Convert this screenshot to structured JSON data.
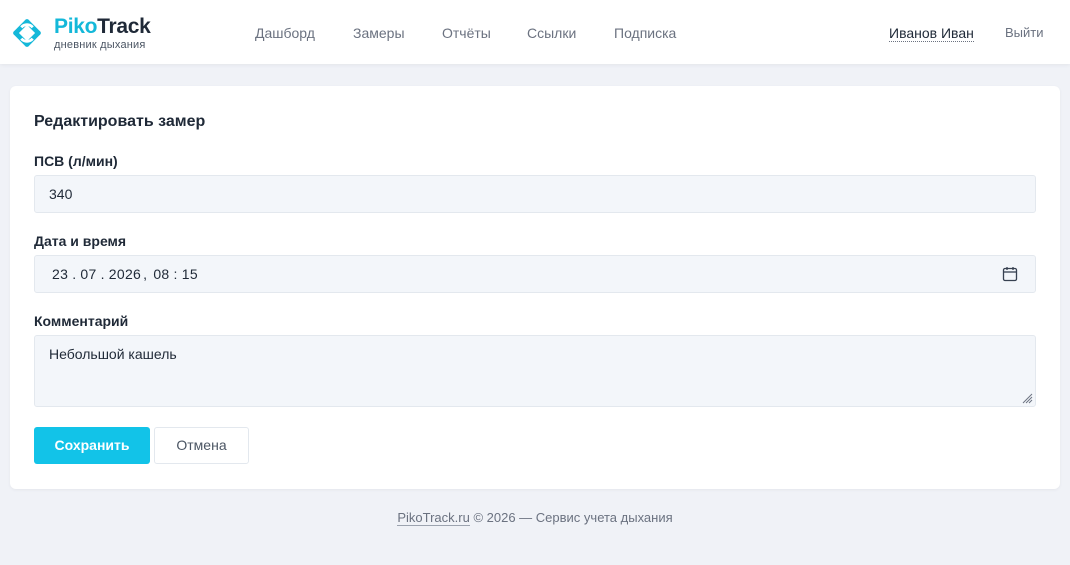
{
  "brand": {
    "name_part1": "Piko",
    "name_part2": "Track",
    "tagline": "дневник дыхания",
    "accent_color": "#14b8d9"
  },
  "nav": {
    "items": [
      {
        "label": "Дашборд"
      },
      {
        "label": "Замеры"
      },
      {
        "label": "Отчёты"
      },
      {
        "label": "Ссылки"
      },
      {
        "label": "Подписка"
      }
    ]
  },
  "user": {
    "name": "Иванов Иван",
    "logout_label": "Выйти"
  },
  "form": {
    "title": "Редактировать замер",
    "pef": {
      "label": "ПСВ (л/мин)",
      "value": "340"
    },
    "datetime": {
      "label": "Дата и время",
      "day": "23",
      "month": "07",
      "year": "2026",
      "hour": "08",
      "minute": "15",
      "icon": "calendar-icon"
    },
    "comment": {
      "label": "Комментарий",
      "value": "Небольшой кашель"
    },
    "save_label": "Сохранить",
    "cancel_label": "Отмена",
    "save_color": "#12c3e8"
  },
  "footer": {
    "link": "PikoTrack.ru",
    "text": " © 2026 — Сервис учета дыхания"
  }
}
